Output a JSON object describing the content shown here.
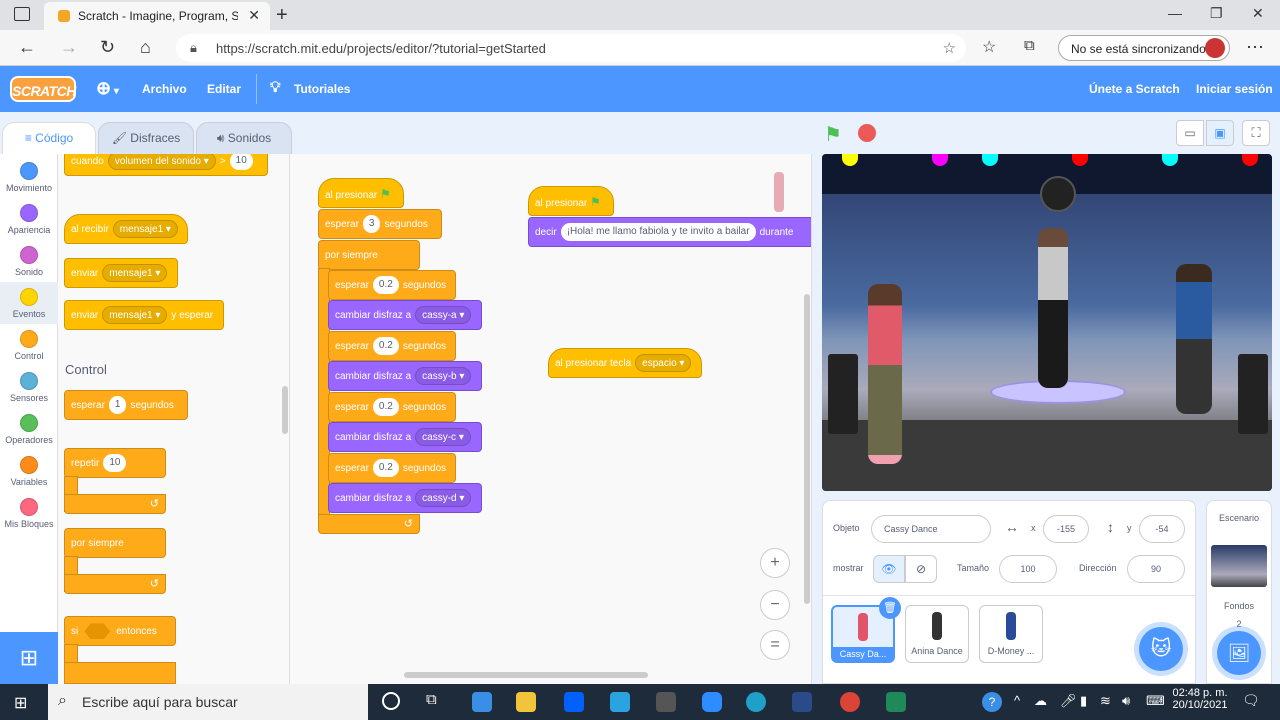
{
  "browser": {
    "tab_title": "Scratch - Imagine, Program, Share",
    "url": "https://scratch.mit.edu/projects/editor/?tutorial=getStarted",
    "sync_label": "No se está sincronizando"
  },
  "menu": {
    "logo": "SCRATCH",
    "file": "Archivo",
    "edit": "Editar",
    "tutorials": "Tutoriales",
    "join": "Únete a Scratch",
    "signin": "Iniciar sesión"
  },
  "tabs": {
    "code": "Código",
    "costumes": "Disfraces",
    "sounds": "Sonidos"
  },
  "categories": [
    {
      "label": "Movimiento",
      "color": "#4c97ff"
    },
    {
      "label": "Apariencia",
      "color": "#9966ff"
    },
    {
      "label": "Sonido",
      "color": "#cf63cf"
    },
    {
      "label": "Eventos",
      "color": "#ffd500"
    },
    {
      "label": "Control",
      "color": "#ffab19"
    },
    {
      "label": "Sensores",
      "color": "#5cb1d6"
    },
    {
      "label": "Operadores",
      "color": "#59c059"
    },
    {
      "label": "Variables",
      "color": "#ff8c1a"
    },
    {
      "label": "Mis Bloques",
      "color": "#ff6680"
    }
  ],
  "palette": {
    "when_loud": "cuando",
    "loud_opt": "volumen del sonido",
    "gt": ">",
    "loud_val": "10",
    "when_receive": "al recibir",
    "msg": "mensaje1",
    "broadcast": "enviar",
    "broadcast_wait": "y esperar",
    "control_heading": "Control",
    "wait": "esperar",
    "wait_val": "1",
    "seconds": "segundos",
    "repeat": "repetir",
    "repeat_val": "10",
    "forever": "por siempre",
    "if": "si",
    "then": "entonces"
  },
  "script1": {
    "hat": "al presionar",
    "wait": "esperar",
    "wait_val": "3",
    "seconds": "segundos",
    "forever": "por siempre",
    "wait_short": "0.2",
    "switch": "cambiar disfraz a",
    "costumes": [
      "cassy-a",
      "cassy-b",
      "cassy-c",
      "cassy-d"
    ]
  },
  "script2": {
    "hat": "al presionar",
    "say": "decir",
    "say_text": "¡Hola! me llamo fabiola y te invito a bailar",
    "during": "durante"
  },
  "script3": {
    "hat": "al presionar tecla",
    "key": "espacio"
  },
  "sprite": {
    "object_label": "Objeto",
    "name": "Cassy Dance",
    "x_label": "x",
    "x": "-155",
    "y_label": "y",
    "y": "-54",
    "show_label": "mostrar",
    "size_label": "Tamaño",
    "size": "100",
    "dir_label": "Dirección",
    "dir": "90"
  },
  "sprites": [
    {
      "name": "Cassy Da...",
      "color": "#e0556a"
    },
    {
      "name": "Anina Dance",
      "color": "#333333"
    },
    {
      "name": "D-Money ...",
      "color": "#2a4a9a"
    }
  ],
  "stage_panel": {
    "title": "Escenario",
    "backdrops": "Fondos",
    "count": "2"
  },
  "taskbar": {
    "search": "Escribe aquí para buscar",
    "time": "02:48 p. m.",
    "date": "20/10/2021"
  }
}
